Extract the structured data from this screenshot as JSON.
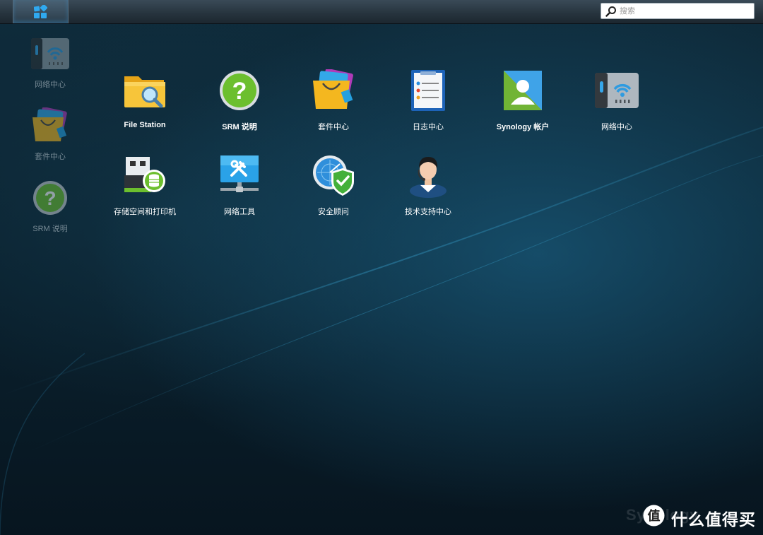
{
  "taskbar": {
    "search": {
      "placeholder": "搜索",
      "value": ""
    }
  },
  "desktop": {
    "shortcuts": [
      {
        "label": "网络中心",
        "icon": "network-center-icon"
      },
      {
        "label": "套件中心",
        "icon": "package-center-icon"
      },
      {
        "label": "SRM 说明",
        "icon": "help-icon"
      }
    ]
  },
  "main_menu": {
    "apps": [
      {
        "label": "File Station",
        "icon": "folder-search-icon"
      },
      {
        "label": "SRM 说明",
        "icon": "help-icon"
      },
      {
        "label": "套件中心",
        "icon": "package-center-icon"
      },
      {
        "label": "日志中心",
        "icon": "log-center-icon"
      },
      {
        "label": "Synology 帐户",
        "icon": "account-icon"
      },
      {
        "label": "网络中心",
        "icon": "network-center-icon"
      },
      {
        "label": "存储空间和打印机",
        "icon": "storage-printer-icon"
      },
      {
        "label": "网络工具",
        "icon": "network-tools-icon"
      },
      {
        "label": "安全顾问",
        "icon": "security-advisor-icon"
      },
      {
        "label": "技术支持中心",
        "icon": "support-center-icon"
      }
    ]
  },
  "watermark": {
    "text": "Synology"
  },
  "brand": {
    "text": "什么值得买"
  },
  "colors": {
    "accent": "#2a9fe8",
    "background": "#0b2331",
    "help_green": "#6cbf2e"
  }
}
